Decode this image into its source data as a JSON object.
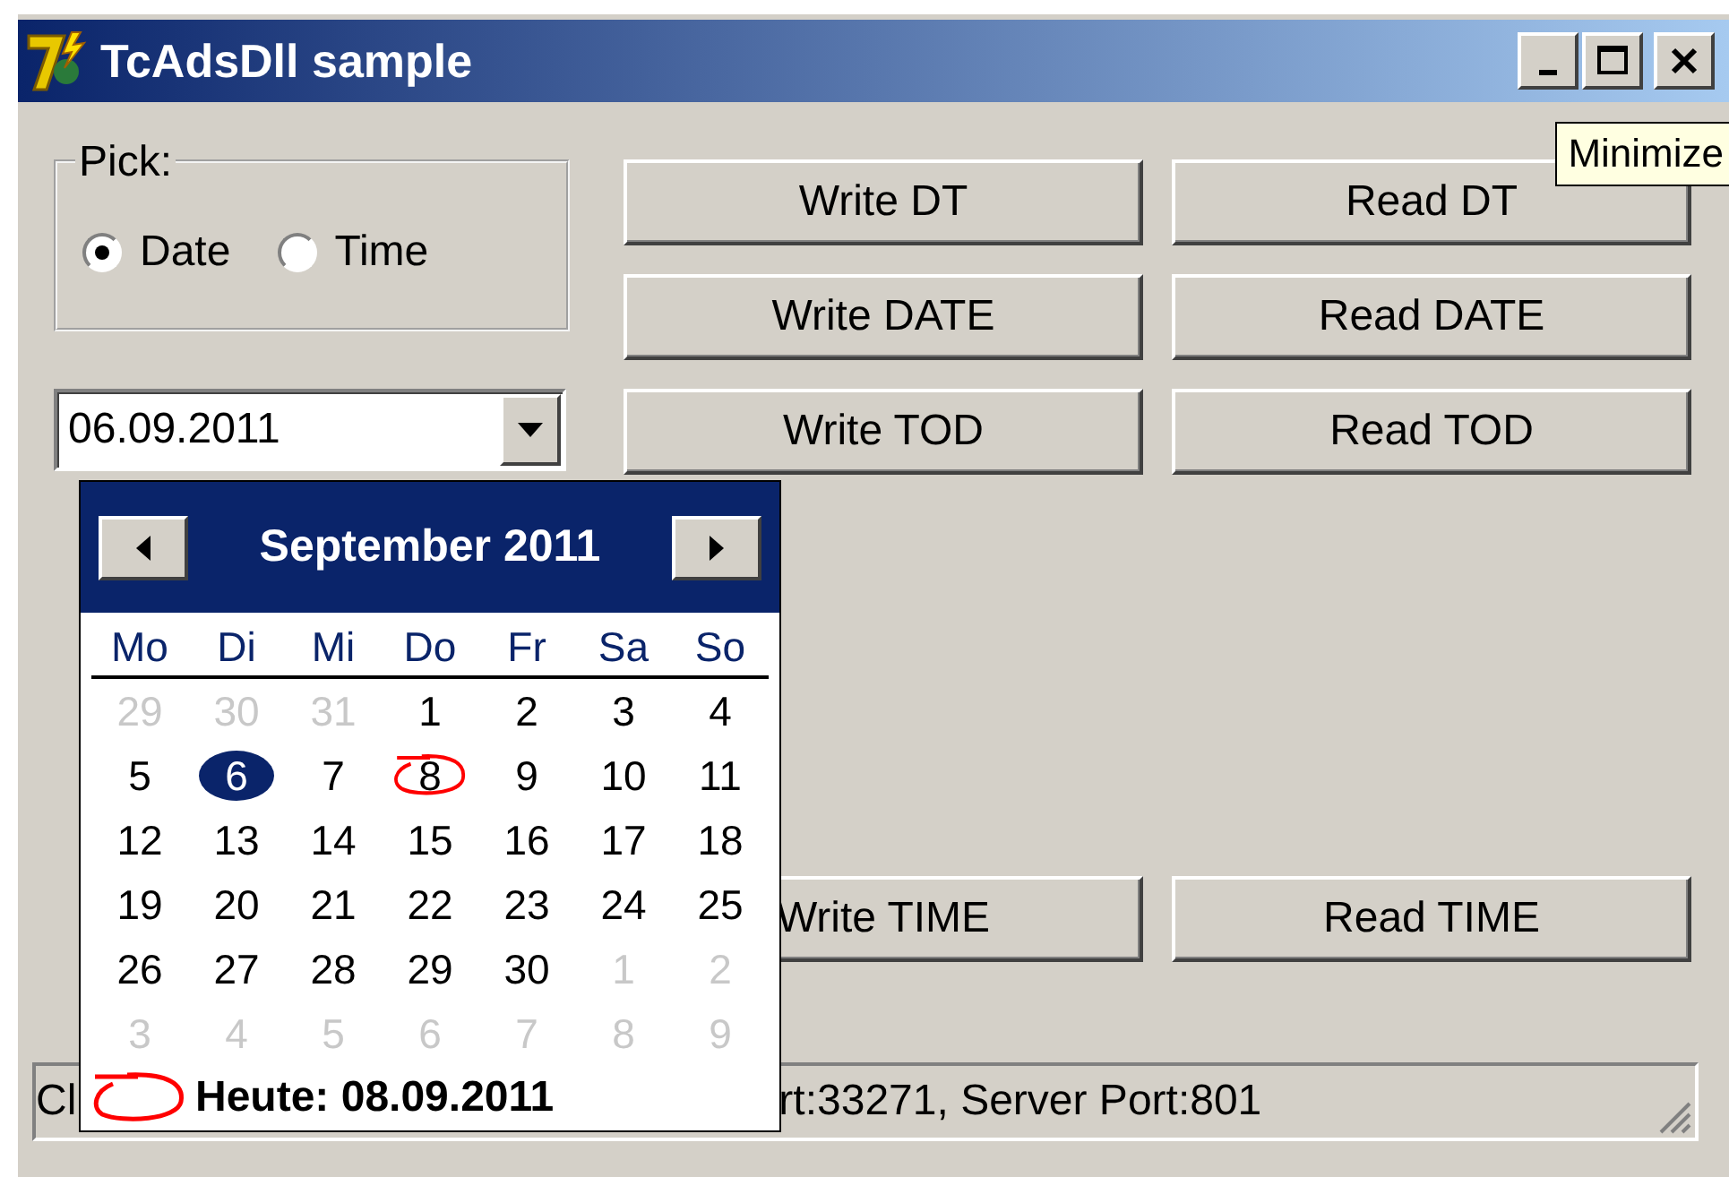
{
  "window": {
    "title": "TcAdsDll sample"
  },
  "tooltip": "Minimize",
  "pick": {
    "label": "Pick:",
    "options": [
      {
        "label": "Date",
        "selected": true
      },
      {
        "label": "Time",
        "selected": false
      }
    ]
  },
  "date_field": {
    "value": "06.09.2011"
  },
  "buttons": [
    {
      "label": "Write DT"
    },
    {
      "label": "Read DT"
    },
    {
      "label": "Write DATE"
    },
    {
      "label": "Read DATE"
    },
    {
      "label": "Write TOD"
    },
    {
      "label": "Read TOD"
    }
  ],
  "time_buttons": [
    {
      "label": "Write TIME"
    },
    {
      "label": "Read TIME"
    }
  ],
  "calendar": {
    "month": "September 2011",
    "weekdays": [
      "Mo",
      "Di",
      "Mi",
      "Do",
      "Fr",
      "Sa",
      "So"
    ],
    "weeks": [
      [
        {
          "text": "29",
          "other": true,
          "selected": false,
          "today": false
        },
        {
          "text": "30",
          "other": true,
          "selected": false,
          "today": false
        },
        {
          "text": "31",
          "other": true,
          "selected": false,
          "today": false
        },
        {
          "text": "1",
          "other": false,
          "selected": false,
          "today": false
        },
        {
          "text": "2",
          "other": false,
          "selected": false,
          "today": false
        },
        {
          "text": "3",
          "other": false,
          "selected": false,
          "today": false
        },
        {
          "text": "4",
          "other": false,
          "selected": false,
          "today": false
        }
      ],
      [
        {
          "text": "5",
          "other": false,
          "selected": false,
          "today": false
        },
        {
          "text": "6",
          "other": false,
          "selected": true,
          "today": false
        },
        {
          "text": "7",
          "other": false,
          "selected": false,
          "today": false
        },
        {
          "text": "8",
          "other": false,
          "selected": false,
          "today": true
        },
        {
          "text": "9",
          "other": false,
          "selected": false,
          "today": false
        },
        {
          "text": "10",
          "other": false,
          "selected": false,
          "today": false
        },
        {
          "text": "11",
          "other": false,
          "selected": false,
          "today": false
        }
      ],
      [
        {
          "text": "12",
          "other": false,
          "selected": false,
          "today": false
        },
        {
          "text": "13",
          "other": false,
          "selected": false,
          "today": false
        },
        {
          "text": "14",
          "other": false,
          "selected": false,
          "today": false
        },
        {
          "text": "15",
          "other": false,
          "selected": false,
          "today": false
        },
        {
          "text": "16",
          "other": false,
          "selected": false,
          "today": false
        },
        {
          "text": "17",
          "other": false,
          "selected": false,
          "today": false
        },
        {
          "text": "18",
          "other": false,
          "selected": false,
          "today": false
        }
      ],
      [
        {
          "text": "19",
          "other": false,
          "selected": false,
          "today": false
        },
        {
          "text": "20",
          "other": false,
          "selected": false,
          "today": false
        },
        {
          "text": "21",
          "other": false,
          "selected": false,
          "today": false
        },
        {
          "text": "22",
          "other": false,
          "selected": false,
          "today": false
        },
        {
          "text": "23",
          "other": false,
          "selected": false,
          "today": false
        },
        {
          "text": "24",
          "other": false,
          "selected": false,
          "today": false
        },
        {
          "text": "25",
          "other": false,
          "selected": false,
          "today": false
        }
      ],
      [
        {
          "text": "26",
          "other": false,
          "selected": false,
          "today": false
        },
        {
          "text": "27",
          "other": false,
          "selected": false,
          "today": false
        },
        {
          "text": "28",
          "other": false,
          "selected": false,
          "today": false
        },
        {
          "text": "29",
          "other": false,
          "selected": false,
          "today": false
        },
        {
          "text": "30",
          "other": false,
          "selected": false,
          "today": false
        },
        {
          "text": "1",
          "other": true,
          "selected": false,
          "today": false
        },
        {
          "text": "2",
          "other": true,
          "selected": false,
          "today": false
        }
      ],
      [
        {
          "text": "3",
          "other": true,
          "selected": false,
          "today": false
        },
        {
          "text": "4",
          "other": true,
          "selected": false,
          "today": false
        },
        {
          "text": "5",
          "other": true,
          "selected": false,
          "today": false
        },
        {
          "text": "6",
          "other": true,
          "selected": false,
          "today": false
        },
        {
          "text": "7",
          "other": true,
          "selected": false,
          "today": false
        },
        {
          "text": "8",
          "other": true,
          "selected": false,
          "today": false
        },
        {
          "text": "9",
          "other": true,
          "selected": false,
          "today": false
        }
      ]
    ],
    "today_label": "Heute: 08.09.2011"
  },
  "status_bar": {
    "left": "Cl",
    "right": "rt:33271,  Server Port:801"
  }
}
